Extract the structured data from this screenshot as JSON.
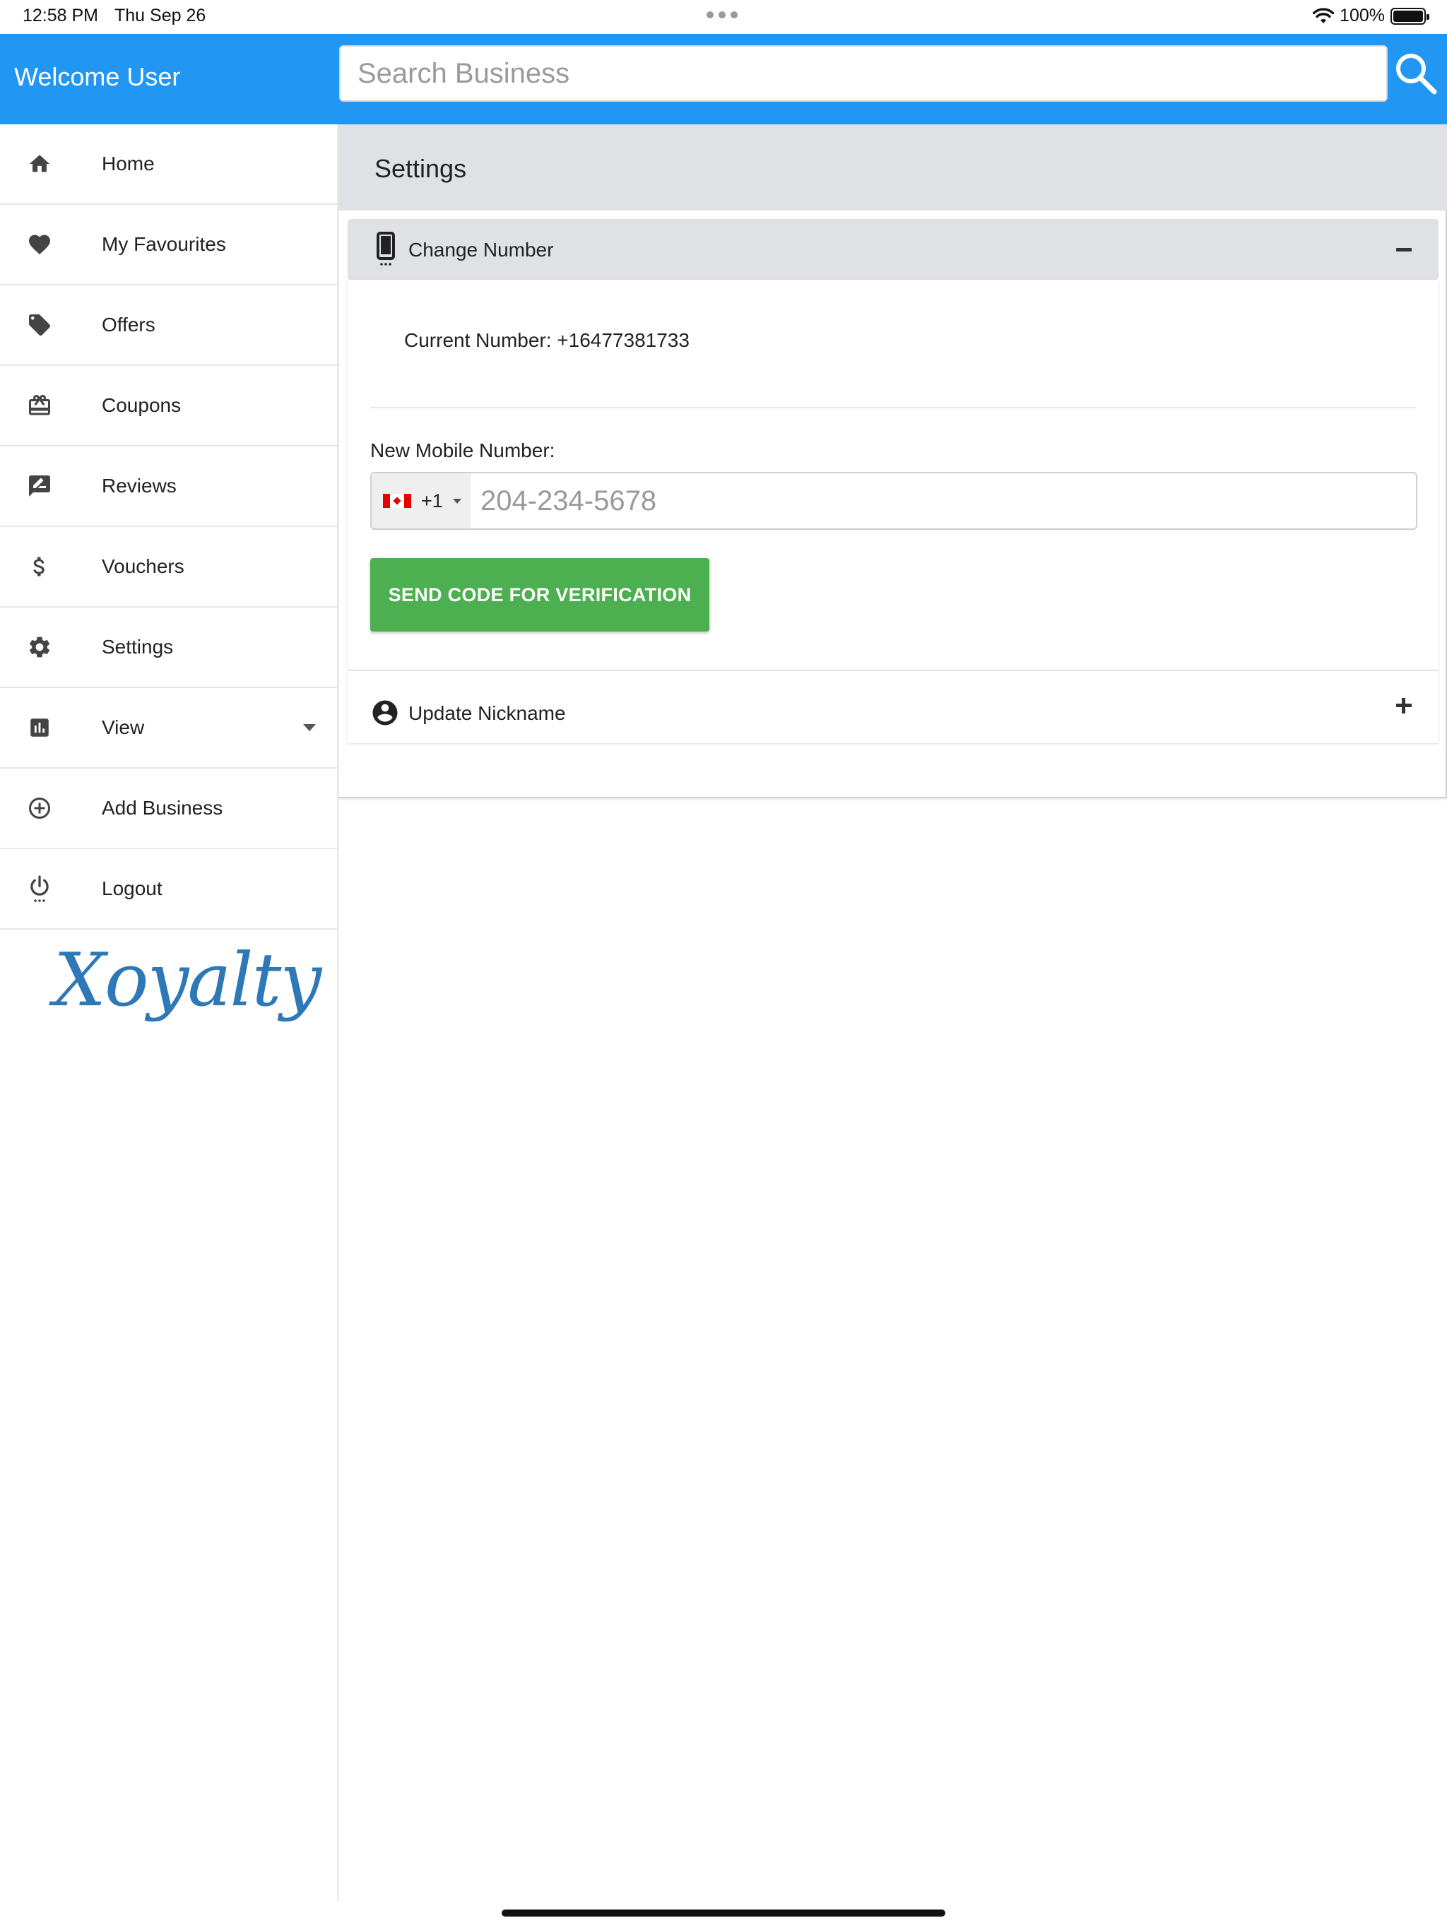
{
  "status_bar": {
    "time": "12:58 PM",
    "date": "Thu Sep 26",
    "battery": "100%"
  },
  "header": {
    "welcome": "Welcome User",
    "search_placeholder": "Search Business",
    "accent_color": "#2196f3"
  },
  "sidebar": {
    "items": [
      {
        "label": "Home",
        "icon": "home-icon"
      },
      {
        "label": "My Favourites",
        "icon": "heart-icon"
      },
      {
        "label": "Offers",
        "icon": "tag-icon"
      },
      {
        "label": "Coupons",
        "icon": "gift-card-icon"
      },
      {
        "label": "Reviews",
        "icon": "rate-review-icon"
      },
      {
        "label": "Vouchers",
        "icon": "dollar-icon"
      },
      {
        "label": "Settings",
        "icon": "gear-icon"
      },
      {
        "label": "View",
        "icon": "chart-icon"
      },
      {
        "label": "Add Business",
        "icon": "add-circle-icon"
      },
      {
        "label": "Logout",
        "icon": "power-icon"
      }
    ],
    "logo": "Xoyalty"
  },
  "settings": {
    "title": "Settings",
    "change_number": {
      "title": "Change Number",
      "current_number": "Current Number: +16477381733",
      "new_label": "New Mobile Number:",
      "country_code": "+1",
      "phone_placeholder": "204-234-5678",
      "send_button": "SEND CODE FOR VERIFICATION",
      "button_color": "#4caf50"
    },
    "update_nickname": {
      "title": "Update Nickname"
    }
  }
}
